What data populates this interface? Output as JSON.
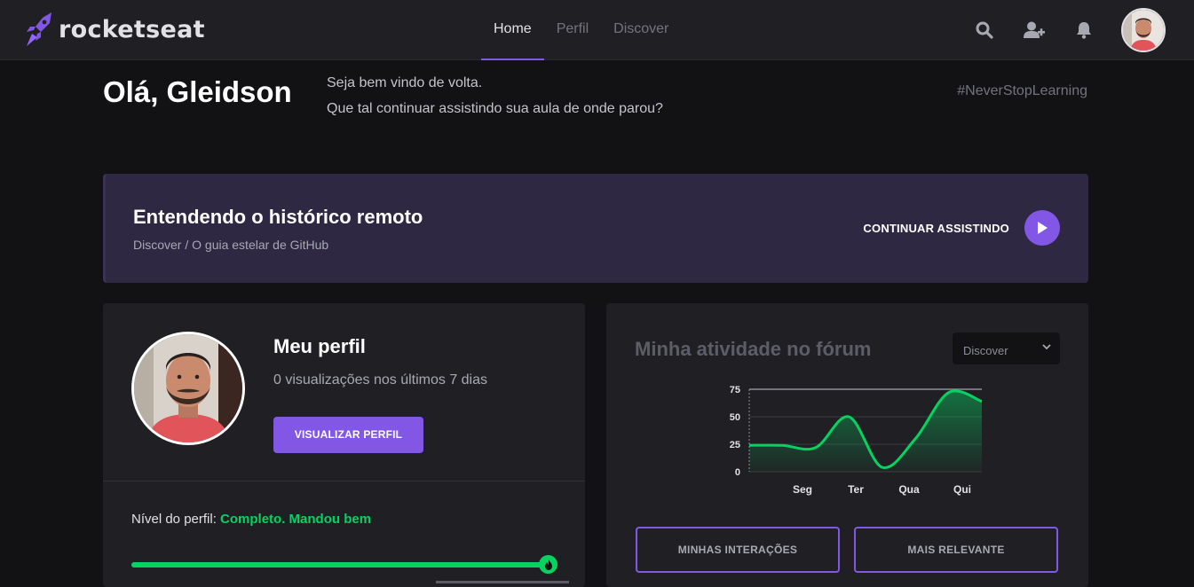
{
  "header": {
    "logo_text": "rocketseat",
    "nav": [
      {
        "label": "Home",
        "active": true
      },
      {
        "label": "Perfil",
        "active": false
      },
      {
        "label": "Discover",
        "active": false
      }
    ],
    "icons": [
      "search-icon",
      "add-user-icon",
      "bell-icon"
    ]
  },
  "greeting": {
    "title": "Olá, Gleidson",
    "line1": "Seja bem vindo de volta.",
    "line2": "Que tal continuar assistindo sua aula de onde parou?",
    "hashtag": "#NeverStopLearning"
  },
  "continue_card": {
    "title": "Entendendo o histórico remoto",
    "subtitle": "Discover / O guia estelar de GitHub",
    "button_label": "CONTINUAR ASSISTINDO"
  },
  "profile": {
    "title": "Meu perfil",
    "views": "0 visualizações nos últimos 7 dias",
    "button_label": "VISUALIZAR PERFIL",
    "level_label": "Nível do perfil: ",
    "level_status": "Completo. Mandou bem",
    "progress": 1.0
  },
  "forum": {
    "title": "Minha atividade no fórum",
    "select_value": "Discover",
    "button_interactions": "MINHAS INTERAÇÕES",
    "button_relevant": "MAIS RELEVANTE"
  },
  "chart_data": {
    "type": "area",
    "categories": [
      "Seg",
      "Ter",
      "Qua",
      "Qui"
    ],
    "x": [
      0,
      1,
      2,
      3,
      4,
      5,
      6,
      7,
      8
    ],
    "values": [
      24,
      24,
      22,
      50,
      4,
      30,
      72,
      64
    ],
    "yticks": [
      0,
      25,
      50,
      75
    ],
    "ylim": [
      0,
      75
    ],
    "line_color": "#04d361",
    "grid": true
  },
  "colors": {
    "accent": "#8257e5",
    "success": "#04d361",
    "background": "#121214",
    "card": "#202024"
  }
}
